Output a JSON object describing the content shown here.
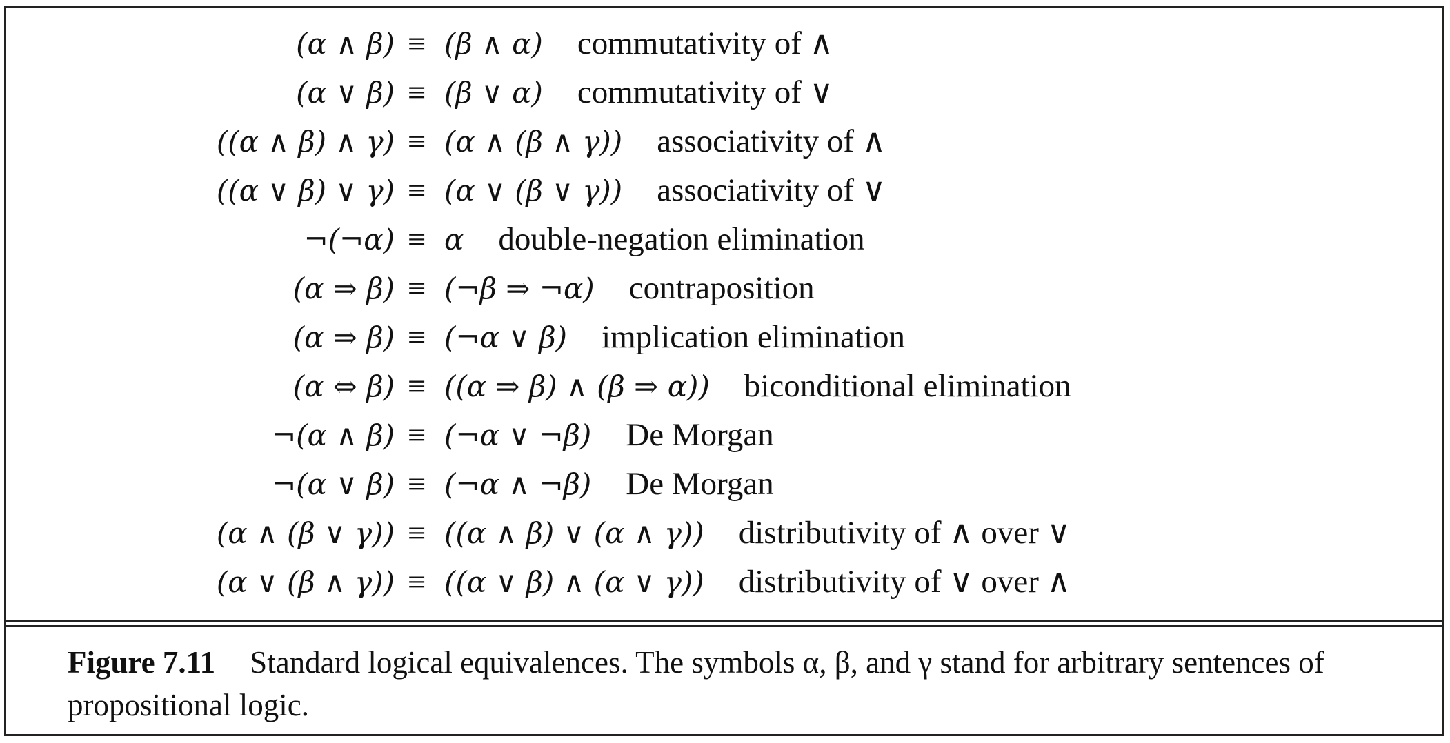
{
  "equivalences": [
    {
      "lhs": "(α ∧ β)",
      "eq": "≡",
      "rhs": "(β ∧ α)",
      "name": "commutativity of ∧"
    },
    {
      "lhs": "(α ∨ β)",
      "eq": "≡",
      "rhs": "(β ∨ α)",
      "name": "commutativity of ∨"
    },
    {
      "lhs": "((α ∧ β) ∧ γ)",
      "eq": "≡",
      "rhs": "(α ∧ (β ∧ γ))",
      "name": "associativity of ∧"
    },
    {
      "lhs": "((α ∨ β) ∨ γ)",
      "eq": "≡",
      "rhs": "(α ∨ (β ∨ γ))",
      "name": "associativity of ∨"
    },
    {
      "lhs": "¬(¬α)",
      "eq": "≡",
      "rhs": "α",
      "name": "double-negation elimination"
    },
    {
      "lhs": "(α ⇒ β)",
      "eq": "≡",
      "rhs": "(¬β ⇒ ¬α)",
      "name": "contraposition"
    },
    {
      "lhs": "(α ⇒ β)",
      "eq": "≡",
      "rhs": "(¬α ∨ β)",
      "name": "implication elimination"
    },
    {
      "lhs": "(α ⇔ β)",
      "eq": "≡",
      "rhs": "((α ⇒ β) ∧ (β ⇒ α))",
      "name": "biconditional elimination"
    },
    {
      "lhs": "¬(α ∧ β)",
      "eq": "≡",
      "rhs": "(¬α ∨ ¬β)",
      "name": "De Morgan"
    },
    {
      "lhs": "¬(α ∨ β)",
      "eq": "≡",
      "rhs": "(¬α ∧ ¬β)",
      "name": "De Morgan"
    },
    {
      "lhs": "(α ∧ (β ∨ γ))",
      "eq": "≡",
      "rhs": "((α ∧ β) ∨ (α ∧ γ))",
      "name": "distributivity of  ∧  over ∨"
    },
    {
      "lhs": "(α ∨ (β ∧ γ))",
      "eq": "≡",
      "rhs": "((α ∨ β) ∧ (α ∨ γ))",
      "name": "distributivity of  ∨  over ∧"
    }
  ],
  "caption": {
    "label": "Figure 7.11",
    "text": "Standard logical equivalences. The symbols α, β, and γ stand for arbitrary sentences of propositional logic."
  }
}
